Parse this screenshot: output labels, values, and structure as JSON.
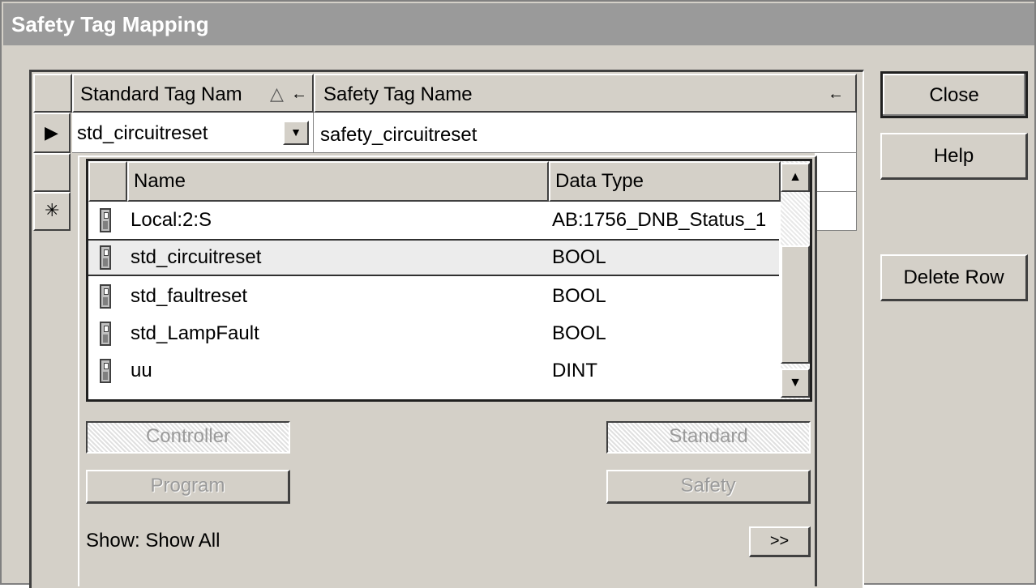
{
  "window": {
    "title": "Safety Tag Mapping"
  },
  "grid": {
    "columns": [
      {
        "label": "Standard Tag Nam",
        "sort_glyph": "△",
        "arrow": "←"
      },
      {
        "label": "Safety Tag Name",
        "arrow": "←"
      }
    ],
    "current_row": {
      "standard_tag": "std_circuitreset",
      "safety_tag": "safety_circuitreset"
    },
    "row_markers": [
      "▶",
      "",
      "✳"
    ]
  },
  "tag_browser": {
    "columns": {
      "name": "Name",
      "data_type": "Data Type"
    },
    "rows": [
      {
        "name": "Local:2:S",
        "data_type": "AB:1756_DNB_Status_1",
        "selected": false
      },
      {
        "name": "std_circuitreset",
        "data_type": "BOOL",
        "selected": true
      },
      {
        "name": "std_faultreset",
        "data_type": "BOOL",
        "selected": false
      },
      {
        "name": "std_LampFault",
        "data_type": "BOOL",
        "selected": false
      },
      {
        "name": "uu",
        "data_type": "DINT",
        "selected": false
      }
    ],
    "scope_buttons": {
      "controller": "Controller",
      "program": "Program"
    },
    "class_buttons": {
      "standard": "Standard",
      "safety": "Safety"
    },
    "show_label": "Show: Show All",
    "more_button": ">>"
  },
  "side_buttons": {
    "close": "Close",
    "help": "Help",
    "delete_row": "Delete Row"
  },
  "icons": {
    "row_current": "triangle-right-icon",
    "row_new": "asterisk-icon",
    "dropdown": "chevron-down-icon",
    "tag": "tag-icon",
    "scroll_up": "scroll-up-icon",
    "scroll_down": "scroll-down-icon"
  }
}
